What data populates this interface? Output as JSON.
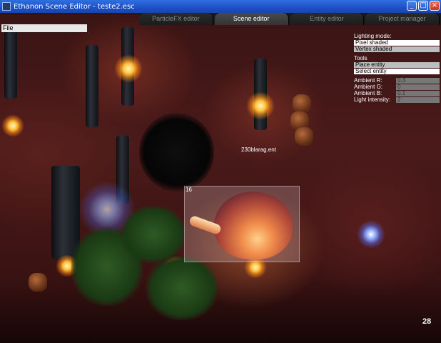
{
  "window": {
    "title": "Ethanon Scene Editor - teste2.esc",
    "controls": {
      "minimize": "_",
      "maximize": "□",
      "close": "×"
    }
  },
  "tabs": [
    {
      "label": "ParticleFX editor",
      "active": false
    },
    {
      "label": "Scene editor",
      "active": true
    },
    {
      "label": "Entity editor",
      "active": false
    },
    {
      "label": "Project manager",
      "active": false
    }
  ],
  "menu": {
    "file": "File"
  },
  "panel": {
    "lighting_mode_label": "Lighting mode:",
    "lighting_options": [
      "Pixel shaded",
      "Vertex shaded"
    ],
    "lighting_selected": "Pixel shaded",
    "tools_label": "Tools",
    "tool_options": [
      "Place entity",
      "Select entity"
    ],
    "tool_selected": "Select entity",
    "ambient_r_label": "Ambient R:",
    "ambient_r": "0.3",
    "ambient_g_label": "Ambient G:",
    "ambient_g": "0",
    "ambient_b_label": "Ambient B:",
    "ambient_b": "0.1",
    "light_intensity_label": "Light intensity:",
    "light_intensity": "2"
  },
  "scene": {
    "selected_entity_id": "16",
    "entity_label": "230blarag.ent",
    "fps": "28"
  },
  "colors": {
    "titlebar": "#2f6fe0",
    "panel_selected": "#ffffff",
    "panel_option": "#bdbdbd"
  }
}
